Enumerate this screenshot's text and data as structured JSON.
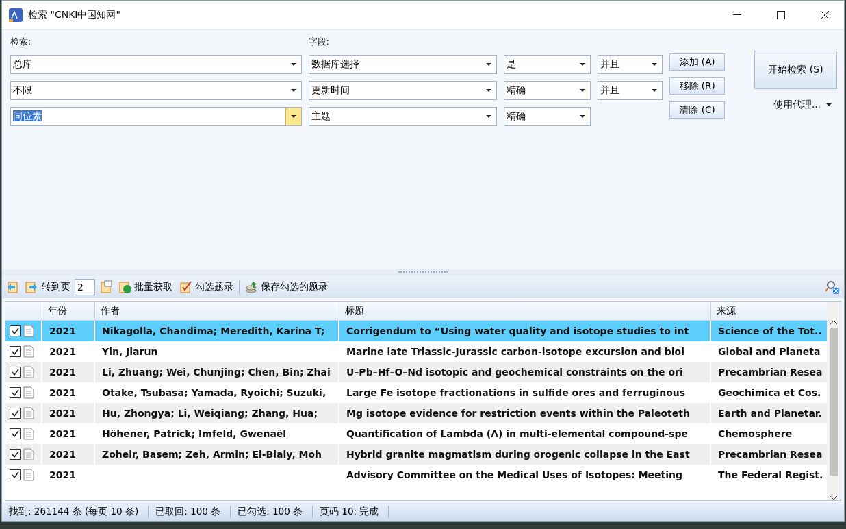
{
  "window": {
    "title": "检索 \"CNKI中国知网\""
  },
  "form": {
    "search_label": "检索:",
    "field_label": "字段:",
    "rows": [
      {
        "term": "总库",
        "term_active": false,
        "field": "数据库选择",
        "match": "是",
        "logic": "并且"
      },
      {
        "term": "不限",
        "term_active": false,
        "field": "更新时间",
        "match": "精确",
        "logic": "并且"
      },
      {
        "term": "同位素",
        "term_active": true,
        "field": "主题",
        "match": "精确"
      }
    ],
    "buttons": [
      "添加 (A)",
      "移除 (R)",
      "清除 (C)"
    ],
    "start_button": "开始检索 (S)",
    "proxy": "使用代理..."
  },
  "toolbar": {
    "goto_label": "转到页",
    "page": "2",
    "batch": "批量获取",
    "check": "勾选题录",
    "save": "保存勾选的题录"
  },
  "table": {
    "columns": [
      "年份",
      "作者",
      "标题",
      "来源"
    ],
    "rows": [
      {
        "checked": true,
        "selected": true,
        "year": "2021",
        "author": "Nikagolla, Chandima; Meredith, Karina T;",
        "title": "Corrigendum to “Using water quality and isotope studies to int",
        "source": "Science of the Tot.."
      },
      {
        "checked": true,
        "selected": false,
        "year": "2021",
        "author": "Yin, Jiarun",
        "title": "Marine late Triassic-Jurassic carbon-isotope excursion and biol",
        "source": "Global and Planeta"
      },
      {
        "checked": true,
        "selected": false,
        "year": "2021",
        "author": "Li, Zhuang; Wei, Chunjing; Chen, Bin; Zhai",
        "title": "U–Pb–Hf–O–Nd isotopic and geochemical constraints on the ori",
        "source": "Precambrian Resea"
      },
      {
        "checked": true,
        "selected": false,
        "year": "2021",
        "author": "Otake, Tsubasa; Yamada, Ryoichi; Suzuki,",
        "title": "Large Fe isotope fractionations in sulfide ores and ferruginous",
        "source": "Geochimica et Cos."
      },
      {
        "checked": true,
        "selected": false,
        "year": "2021",
        "author": "Hu, Zhongya; Li, Weiqiang; Zhang, Hua;",
        "title": "Mg isotope evidence for restriction events within the Paleoteth",
        "source": "Earth and Planetar."
      },
      {
        "checked": true,
        "selected": false,
        "year": "2021",
        "author": "Höhener, Patrick; Imfeld, Gwenaël",
        "title": "Quantification of Lambda (Λ) in multi-elemental compound-spe",
        "source": "Chemosphere"
      },
      {
        "checked": true,
        "selected": false,
        "year": "2021",
        "author": "Zoheir, Basem; Zeh, Armin; El-Bialy, Moh",
        "title": "Hybrid granite magmatism during orogenic collapse in the East",
        "source": "Precambrian Resea"
      },
      {
        "checked": true,
        "selected": false,
        "year": "2021",
        "title": "Advisory Committee on the Medical Uses of Isotopes: Meeting",
        "source": "The Federal Regist."
      }
    ]
  },
  "status_bar": [
    "找到: 261144 条 (每页 10 条)",
    "已取回: 100 条",
    "已勾选: 100 条",
    "页码 10: 完成"
  ]
}
